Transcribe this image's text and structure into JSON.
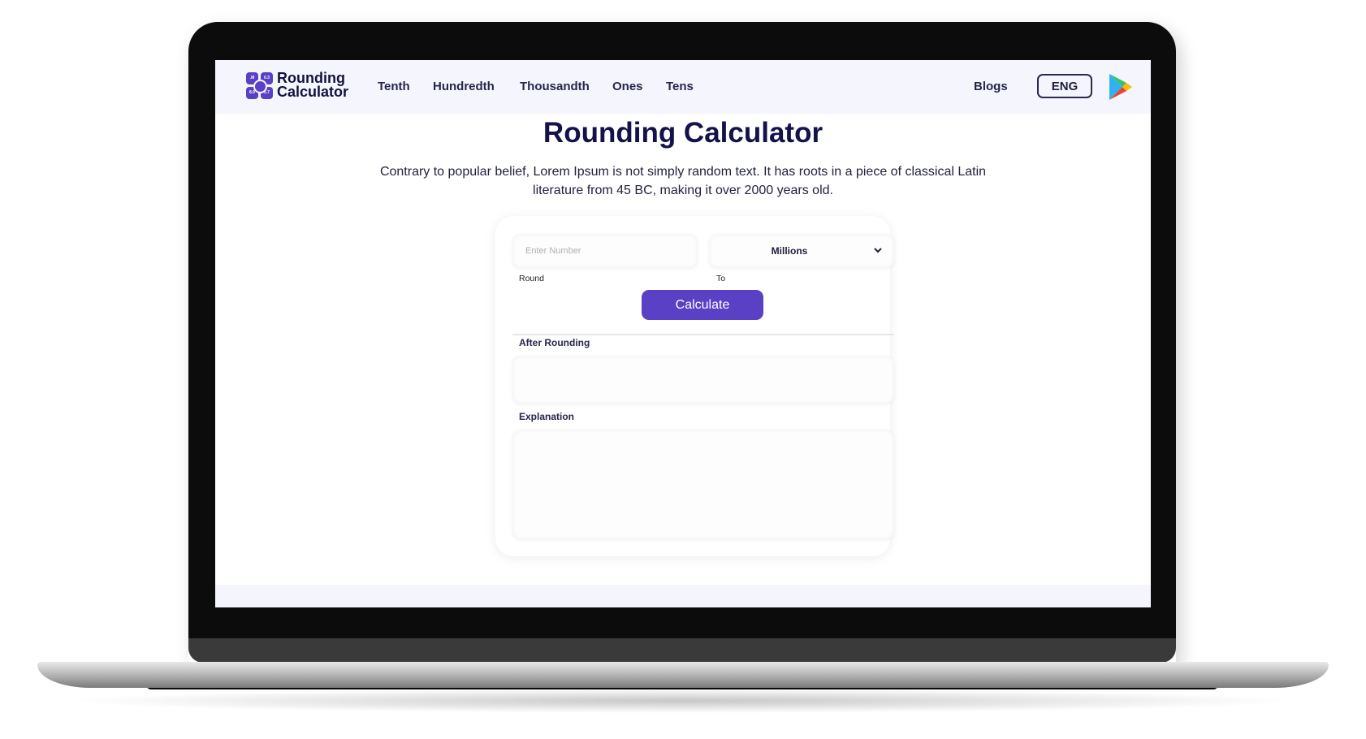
{
  "nav": {
    "logo_line1": "Rounding",
    "logo_line2": "Calculator",
    "logo_tiles": [
      ".M",
      "0.3",
      "8.9",
      "5.7"
    ],
    "links": [
      "Tenth",
      "Hundredth",
      "Thousandth",
      "Ones",
      "Tens"
    ],
    "blogs": "Blogs",
    "language": "ENG",
    "store_icon": "google-play-icon"
  },
  "main": {
    "title": "Rounding Calculator",
    "description": "Contrary to popular belief, Lorem Ipsum is not simply random text. It has roots in a piece of classical Latin literature from 45 BC, making it over 2000 years old."
  },
  "form": {
    "number_placeholder": "Enter Number",
    "number_value": "",
    "round_label": "Round",
    "to_label": "To",
    "round_to_selected": "Millions",
    "calculate_label": "Calculate",
    "after_rounding_label": "After Rounding",
    "after_rounding_value": "",
    "explanation_label": "Explanation",
    "explanation_value": ""
  },
  "colors": {
    "accent": "#5a40c5",
    "nav_bg": "#f5f5fd",
    "heading": "#14124a"
  }
}
